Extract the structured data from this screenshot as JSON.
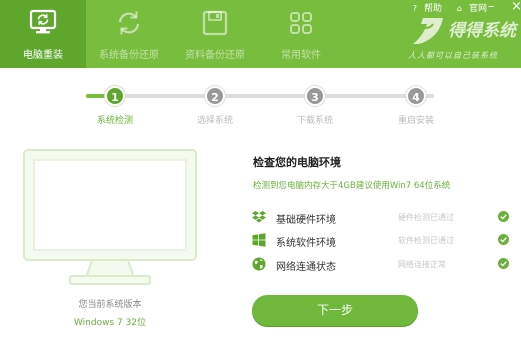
{
  "header": {
    "nav": [
      {
        "label": "电脑重装",
        "icon": "monitor-refresh-icon",
        "active": true
      },
      {
        "label": "系统备份还原",
        "icon": "sync-icon",
        "active": false
      },
      {
        "label": "资料备份还原",
        "icon": "save-icon",
        "active": false
      },
      {
        "label": "常用软件",
        "icon": "apps-grid-icon",
        "active": false
      }
    ],
    "help_label": "帮助",
    "site_label": "官网",
    "minimize_symbol": "–",
    "close_symbol": "×",
    "logo_name": "得得系统",
    "logo_slogan": "人人都可以自己装系统"
  },
  "steps": [
    {
      "number": "1",
      "label": "系统检测",
      "active": true
    },
    {
      "number": "2",
      "label": "选择系统",
      "active": false
    },
    {
      "number": "3",
      "label": "下载系统",
      "active": false
    },
    {
      "number": "4",
      "label": "重启安装",
      "active": false
    }
  ],
  "progress": {
    "completed_steps": 1,
    "total_steps": 4
  },
  "system": {
    "caption": "您当前系统版本",
    "version": "Windows 7 32位"
  },
  "environment": {
    "title": "检查您的电脑环境",
    "description": "检测到您电脑内存大于4GB建议使用Win7 64位系统",
    "checks": [
      {
        "name": "基础硬件环境",
        "status": "硬件检测已通过",
        "icon": "dropbox-icon"
      },
      {
        "name": "系统软件环境",
        "status": "软件检测已通过",
        "icon": "windows-icon"
      },
      {
        "name": "网络连通状态",
        "status": "网络连接正常",
        "icon": "globe-icon"
      }
    ]
  },
  "next_button": "下一步",
  "colors": {
    "header_green": "#79bd3e",
    "active_tab": "#5ea72c",
    "accent_green": "#6ab13a",
    "inactive_step": "#999999"
  }
}
